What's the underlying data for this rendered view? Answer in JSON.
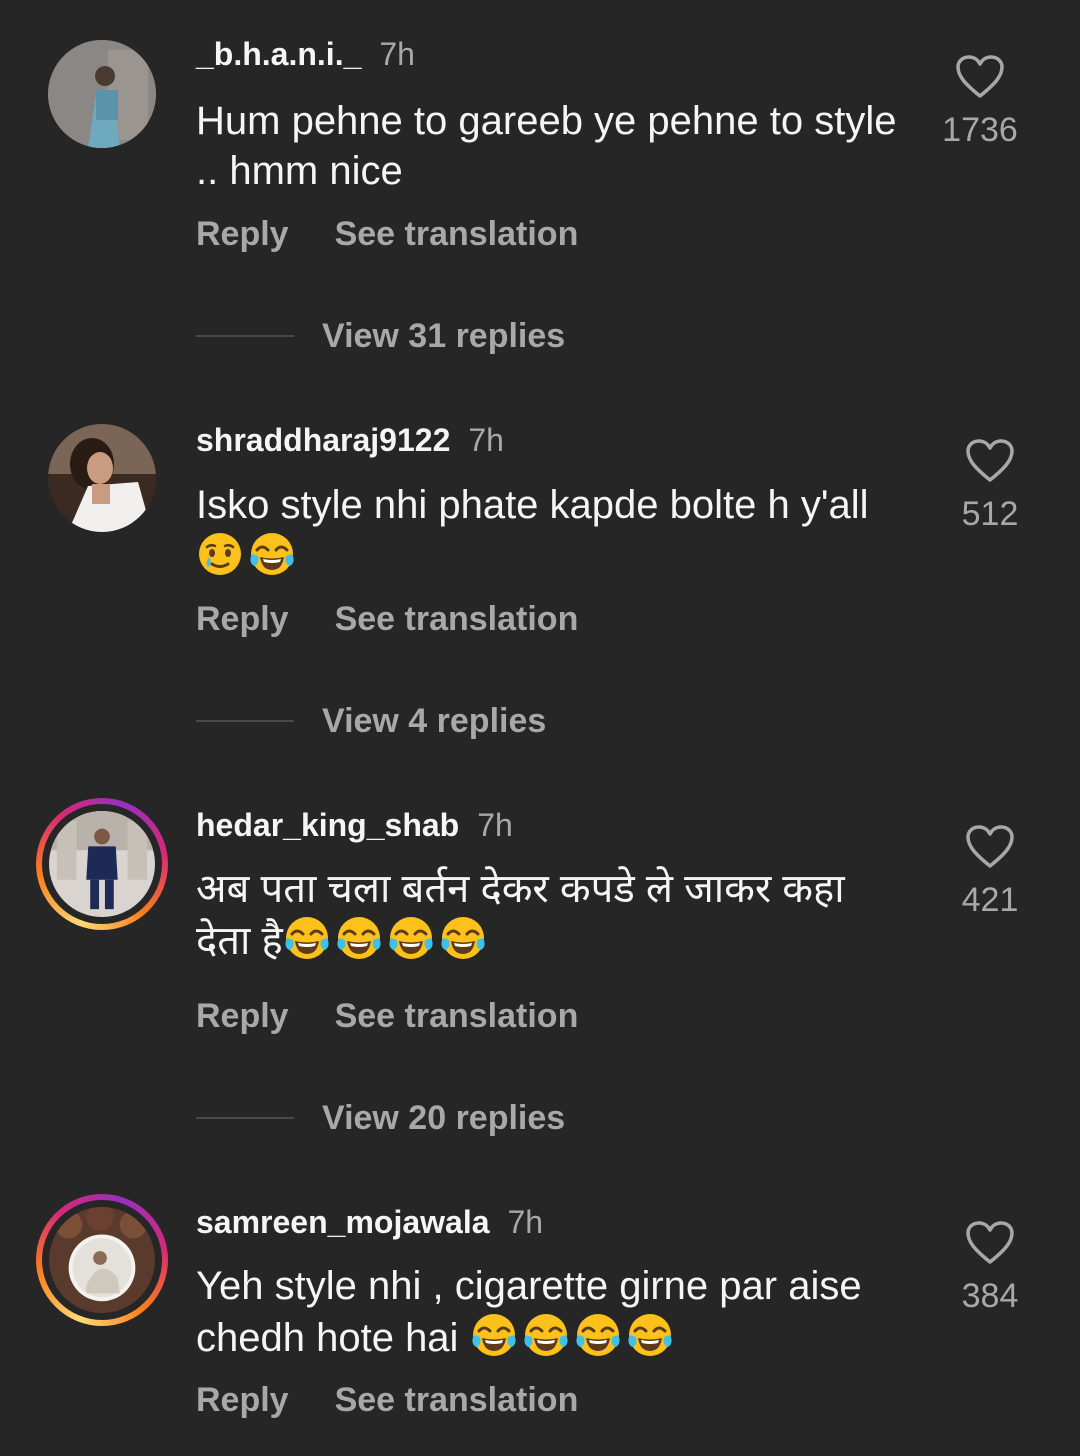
{
  "comments": [
    {
      "username": "_b.h.a.n.i._",
      "time": "7h",
      "text": "Hum pehne to gareeb ye pehne to style .. hmm nice",
      "likes": "1736",
      "reply_label": "Reply",
      "translate_label": "See translation",
      "view_replies": "View 31 replies",
      "has_story": false
    },
    {
      "username": "shraddharaj9122",
      "time": "7h",
      "text": "Isko style nhi phate kapde bolte h y'all",
      "emojis": [
        "smiling-face-with-tear",
        "face-with-tears-of-joy"
      ],
      "likes": "512",
      "reply_label": "Reply",
      "translate_label": "See translation",
      "view_replies": "View 4 replies",
      "has_story": false
    },
    {
      "username": "hedar_king_shab",
      "time": "7h",
      "text_line1": "अब पता चला बर्तन देकर कपडे ले जाकर कहा",
      "text_line2": "देता है",
      "emojis": [
        "face-with-tears-of-joy",
        "face-with-tears-of-joy",
        "face-with-tears-of-joy",
        "face-with-tears-of-joy"
      ],
      "likes": "421",
      "reply_label": "Reply",
      "translate_label": "See translation",
      "view_replies": "View 20 replies",
      "has_story": true
    },
    {
      "username": "samreen_mojawala",
      "time": "7h",
      "text_line1": "Yeh style nhi , cigarette girne par aise",
      "text_line2": "chedh hote hai",
      "emojis": [
        "face-with-tears-of-joy",
        "face-with-tears-of-joy",
        "face-with-tears-of-joy",
        "face-with-tears-of-joy"
      ],
      "likes": "384",
      "reply_label": "Reply",
      "translate_label": "See translation",
      "has_story": true
    }
  ],
  "colors": {
    "background": "#262626",
    "primary_text": "#f5f5f5",
    "secondary_text": "#a8a8a8"
  }
}
